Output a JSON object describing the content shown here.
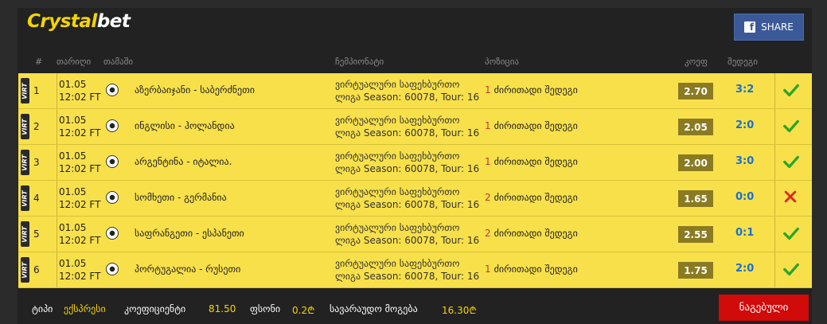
{
  "header": {
    "logo_part1": "Crystal",
    "logo_part2": "bet",
    "share_label": "SHARE",
    "share_icon": "facebook-icon"
  },
  "columns": {
    "num": "#",
    "date": "თარიღი",
    "match": "თამაში",
    "championship": "ჩემპიონატი",
    "position": "პოზიცია",
    "odd": "კოეფ",
    "result": "შედეგი"
  },
  "rows": [
    {
      "num": "1",
      "virt": "VIRT",
      "date": "01.05",
      "time": "12:02 FT",
      "match": "აზერბაიჯანი - საბერძნეთი",
      "champ_line1": "ვირტუალური საფეხბურთო",
      "champ_line2": "ლიგა Season: 60078, Tour: 16",
      "pos_num": "1",
      "pos_label": "ძირითადი შედეგი",
      "odd": "2.70",
      "result": "3:2",
      "status": "win"
    },
    {
      "num": "2",
      "virt": "VIRT",
      "date": "01.05",
      "time": "12:02 FT",
      "match": "ინგლისი - ჰოლანდია",
      "champ_line1": "ვირტუალური საფეხბურთო",
      "champ_line2": "ლიგა Season: 60078, Tour: 16",
      "pos_num": "1",
      "pos_label": "ძირითადი შედეგი",
      "odd": "2.05",
      "result": "2:0",
      "status": "win"
    },
    {
      "num": "3",
      "virt": "VIRT",
      "date": "01.05",
      "time": "12:02 FT",
      "match": "არგენტინა - იტალია.",
      "champ_line1": "ვირტუალური საფეხბურთო",
      "champ_line2": "ლიგა Season: 60078, Tour: 16",
      "pos_num": "1",
      "pos_label": "ძირითადი შედეგი",
      "odd": "2.00",
      "result": "3:0",
      "status": "win"
    },
    {
      "num": "4",
      "virt": "VIRT",
      "date": "01.05",
      "time": "12:02 FT",
      "match": "სომხეთი - გერმანია",
      "champ_line1": "ვირტუალური საფეხბურთო",
      "champ_line2": "ლიგა Season: 60078, Tour: 16",
      "pos_num": "2",
      "pos_label": "ძირითადი შედეგი",
      "odd": "1.65",
      "result": "0:0",
      "status": "loss"
    },
    {
      "num": "5",
      "virt": "VIRT",
      "date": "01.05",
      "time": "12:02 FT",
      "match": "საფრანგეთი - ესპანეთი",
      "champ_line1": "ვირტუალური საფეხბურთო",
      "champ_line2": "ლიგა Season: 60078, Tour: 16",
      "pos_num": "2",
      "pos_label": "ძირითადი შედეგი",
      "odd": "2.55",
      "result": "0:1",
      "status": "win"
    },
    {
      "num": "6",
      "virt": "VIRT",
      "date": "01.05",
      "time": "12:02 FT",
      "match": "პორტუგალია - რუსეთი",
      "champ_line1": "ვირტუალური საფეხბურთო",
      "champ_line2": "ლიგა Season: 60078, Tour: 16",
      "pos_num": "1",
      "pos_label": "ძირითადი შედეგი",
      "odd": "1.75",
      "result": "2:0",
      "status": "win"
    }
  ],
  "footer": {
    "type_label": "ტიპი",
    "type_value": "ექსპრესი",
    "coef_label": "კოეფიციენტი",
    "coef_value": "81.50",
    "price_label": "ფსონი",
    "price_value": "0.2₾",
    "payout_label": "სავარაუდო მოგება",
    "payout_value": "16.30₾",
    "submit_label": "ნაგებული"
  },
  "colors": {
    "row_bg": "#f8e04a",
    "accent_yellow": "#f5d400",
    "win": "#2aa52a",
    "loss": "#e0261e",
    "result_blue": "#1a6fd1",
    "share_bg": "#3b5998",
    "submit_bg": "#d10a0a"
  }
}
